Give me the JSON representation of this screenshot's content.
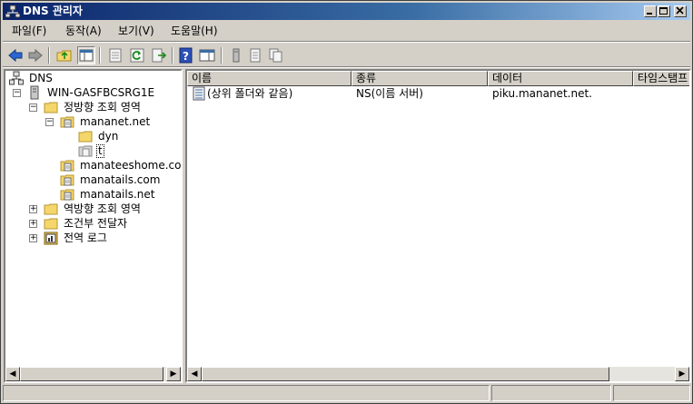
{
  "window": {
    "title": "DNS 관리자"
  },
  "menu": [
    {
      "label": "파일(F)"
    },
    {
      "label": "동작(A)"
    },
    {
      "label": "보기(V)"
    },
    {
      "label": "도움말(H)"
    }
  ],
  "tree": {
    "root": "DNS",
    "server": "WIN-GASFBCSRG1E",
    "forward_zones": "정방향 조회 영역",
    "zone_mananet": "mananet.net",
    "sub_dyn": "dyn",
    "sub_t": "t",
    "zone_manateeshome": "manateeshome.com",
    "zone_manatails_com": "manatails.com",
    "zone_manatails_net": "manatails.net",
    "reverse_zones": "역방향 조회 영역",
    "conditional_forwarders": "조건부 전달자",
    "global_logs": "전역 로그"
  },
  "list": {
    "columns": [
      "이름",
      "종류",
      "데이터",
      "타임스탬프"
    ],
    "rows": [
      {
        "name": "(상위 폴더와 같음)",
        "type": "NS(이름 서버)",
        "data": "piku.mananet.net."
      }
    ]
  },
  "colors": {
    "title_start": "#0a246a",
    "title_end": "#a6caf0",
    "face": "#d4d0c8",
    "folder": "#f5d66b"
  }
}
